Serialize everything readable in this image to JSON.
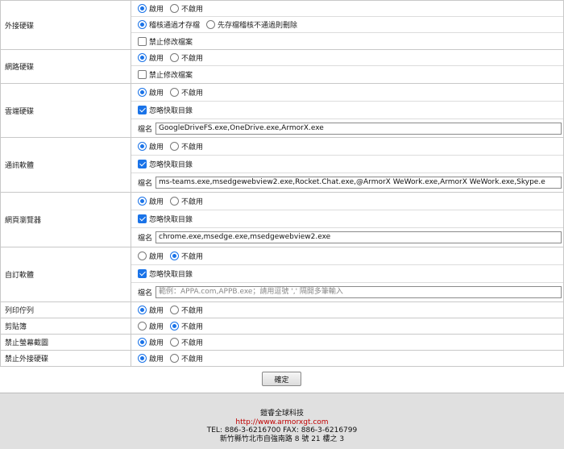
{
  "common": {
    "enable": "啟用",
    "disable": "不啟用",
    "name_label": "檔名"
  },
  "sections": {
    "external_drive": {
      "label": "外接硬碟",
      "enabled": true,
      "option_a": "稽核通過才存檔",
      "option_b": "先存檔稽核不通過則刪除",
      "option_selected": "a",
      "no_modify_label": "禁止修改檔案",
      "no_modify_checked": false
    },
    "network_drive": {
      "label": "網路硬碟",
      "enabled": true,
      "no_modify_label": "禁止修改檔案",
      "no_modify_checked": false
    },
    "cloud_drive": {
      "label": "雲端硬碟",
      "enabled": true,
      "ignore_cache_label": "忽略快取目錄",
      "ignore_cache_checked": true,
      "filenames": "GoogleDriveFS.exe,OneDrive.exe,ArmorX.exe"
    },
    "messaging": {
      "label": "通訊軟體",
      "enabled": true,
      "ignore_cache_label": "忽略快取目錄",
      "ignore_cache_checked": true,
      "filenames": "ms-teams.exe,msedgewebview2.exe,Rocket.Chat.exe,@ArmorX WeWork.exe,ArmorX WeWork.exe,Skype.e"
    },
    "browser": {
      "label": "網頁瀏覽器",
      "enabled": true,
      "ignore_cache_label": "忽略快取目錄",
      "ignore_cache_checked": true,
      "filenames": "chrome.exe,msedge.exe,msedgewebview2.exe"
    },
    "custom_software": {
      "label": "自訂軟體",
      "enabled": false,
      "ignore_cache_label": "忽略快取目錄",
      "ignore_cache_checked": true,
      "filenames": "",
      "placeholder": "範例：APPA.com,APPB.exe；請用逗號 ',' 隔開多筆輸入"
    },
    "print_queue": {
      "label": "列印佇列",
      "enabled": true
    },
    "clipboard": {
      "label": "剪貼簿",
      "enabled": false
    },
    "block_screenshot": {
      "label": "禁止螢幕截圖",
      "enabled": true
    },
    "block_external_drive": {
      "label": "禁止外接硬碟",
      "enabled": true
    }
  },
  "ok_button": "確定",
  "footer": {
    "company": "鎧睿全球科技",
    "url": "http://www.armorxgt.com",
    "contact": "TEL: 886-3-6216700  FAX: 886-3-6216799",
    "address": "新竹縣竹北市自強南路 8 號 21 樓之 3"
  }
}
